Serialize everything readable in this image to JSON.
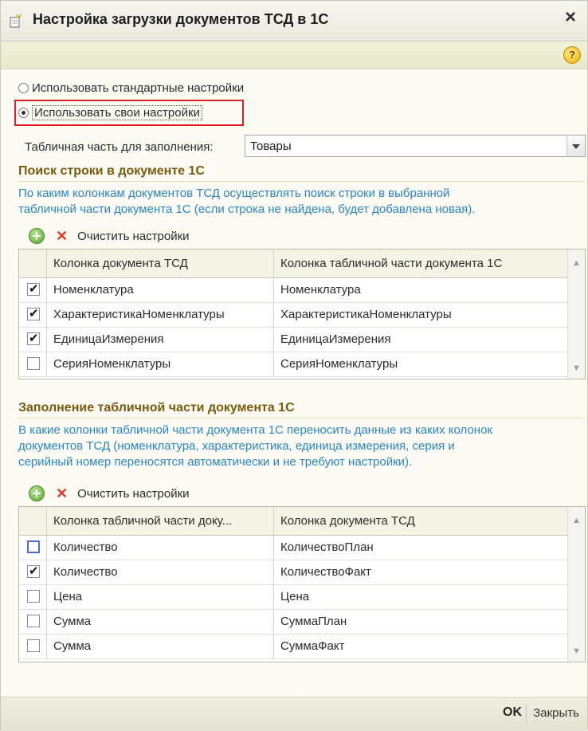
{
  "window": {
    "title": "Настройка загрузки документов ТСД в 1С",
    "close_glyph": "×",
    "help_glyph": "?"
  },
  "options": {
    "standard": "Использовать стандартные настройки",
    "custom": "Использовать свои настройки",
    "selected": "custom"
  },
  "tabular_part": {
    "label": "Табличная часть для заполнения:",
    "value": "Товары"
  },
  "search_section": {
    "title": "Поиск строки в документе 1С",
    "hint_lines": [
      "По каким колонкам документов ТСД осуществлять поиск строки в выбранной",
      "табличной части документа 1С (если строка не найдена, будет добавлена новая)."
    ],
    "clear_label": "Очистить настройки",
    "columns": [
      "Колонка документа ТСД",
      "Колонка табличной части документа 1С"
    ],
    "rows": [
      {
        "checked": true,
        "tsd": "Номенклатура",
        "doc": "Номенклатура"
      },
      {
        "checked": true,
        "tsd": "ХарактеристикаНоменклатуры",
        "doc": "ХарактеристикаНоменклатуры"
      },
      {
        "checked": true,
        "tsd": "ЕдиницаИзмерения",
        "doc": "ЕдиницаИзмерения"
      },
      {
        "checked": false,
        "tsd": "СерияНоменклатуры",
        "doc": "СерияНоменклатуры"
      }
    ]
  },
  "fill_section": {
    "title": "Заполнение табличной части документа 1С",
    "hint_lines": [
      "В какие колонки табличной части документа 1С переносить данные из каких колонок",
      "документов ТСД  (номенклатура, характеристика, единица измерения, серия и",
      "серийный номер переносятся автоматически и не требуют настройки)."
    ],
    "clear_label": "Очистить настройки",
    "columns": [
      "Колонка табличной части доку...",
      "Колонка документа ТСД"
    ],
    "rows": [
      {
        "checked": false,
        "doc": "Количество",
        "tsd": "КоличествоПлан"
      },
      {
        "checked": true,
        "doc": "Количество",
        "tsd": "КоличествоФакт"
      },
      {
        "checked": false,
        "doc": "Цена",
        "tsd": "Цена"
      },
      {
        "checked": false,
        "doc": "Сумма",
        "tsd": "СуммаПлан"
      },
      {
        "checked": false,
        "doc": "Сумма",
        "tsd": "СуммаФакт"
      }
    ]
  },
  "footer": {
    "ok": "OK",
    "close": "Закрыть"
  },
  "colors": {
    "accent_title": "#7b5a10",
    "hint": "#2a86c9",
    "highlight": "#e02020"
  }
}
